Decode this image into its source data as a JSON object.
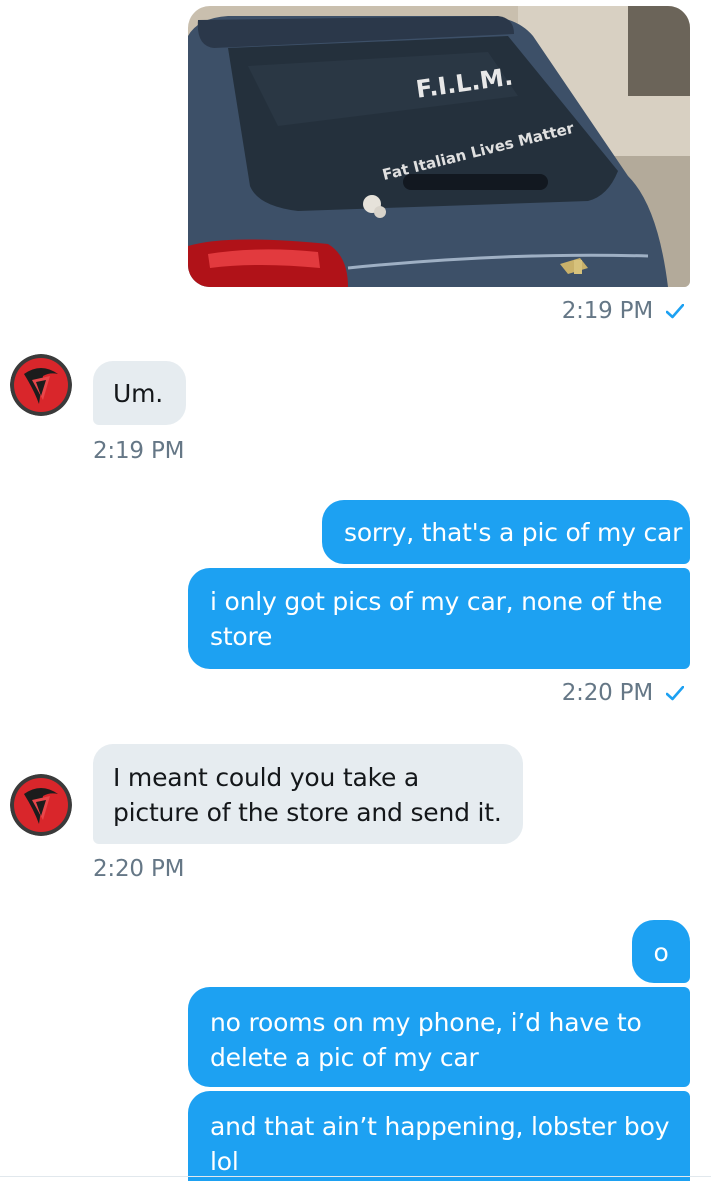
{
  "conversation": {
    "messages": [
      {
        "id": "m1",
        "text": "sorry, that's a pic of my car"
      },
      {
        "id": "m2",
        "text": "i only got pics of my car, none of the store"
      },
      {
        "id": "m3",
        "text": "Um."
      },
      {
        "id": "m4",
        "text": "I meant could you take a picture of the store and send it."
      },
      {
        "id": "m5",
        "text": "o"
      },
      {
        "id": "m6",
        "text": "no rooms on my phone, i’d have to delete a pic of my car"
      },
      {
        "id": "m7",
        "text": "and that ain’t happening, lobster boy lol"
      }
    ],
    "timestamps": {
      "photo_time": "2:19 PM",
      "um_time": "2:19 PM",
      "sorry_time": "2:20 PM",
      "meant_time": "2:20 PM"
    },
    "photo": {
      "sticker_title": "F.I.L.M.",
      "sticker_subtitle": "Fat Italian Lives Matter"
    },
    "icons": {
      "read_receipt": "check-icon",
      "avatar": "red-sword-emblem-avatar"
    },
    "colors": {
      "outgoing_bubble": "#1da1f2",
      "incoming_bubble": "#e6ecf0",
      "timestamp": "#657786",
      "check": "#1da1f2"
    }
  }
}
